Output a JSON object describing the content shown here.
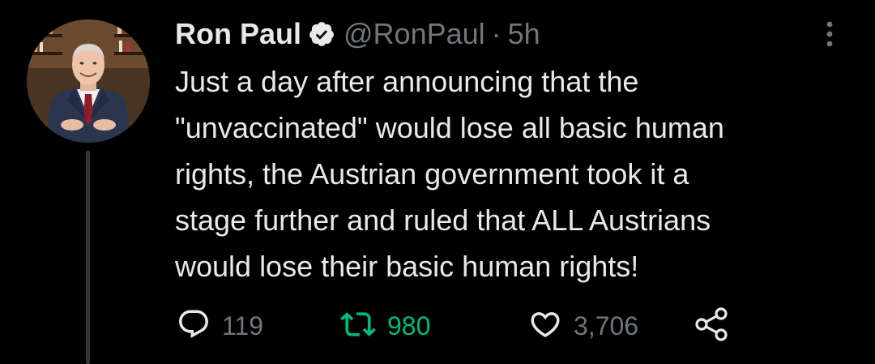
{
  "tweet": {
    "author_name": "Ron Paul",
    "handle": "@RonPaul",
    "separator": "·",
    "time": "5h",
    "text": "Just a day after announcing that the\n\"unvaccinated\" would lose all basic human\nrights, the Austrian government took it a\nstage further and ruled that ALL Austrians\nwould lose their basic human rights!",
    "verified": true
  },
  "actions": {
    "reply_count": "119",
    "retweet_count": "980",
    "like_count": "3,706"
  },
  "icons": {
    "verified": "verified-badge-icon",
    "more": "more-vertical-icon",
    "reply": "reply-icon",
    "retweet": "retweet-icon",
    "like": "heart-icon",
    "share": "share-icon"
  },
  "colors": {
    "background": "#000000",
    "text": "#e7e9ea",
    "secondary": "#71767b",
    "retweet_active": "#00ba7c",
    "thread_line": "#333639"
  }
}
